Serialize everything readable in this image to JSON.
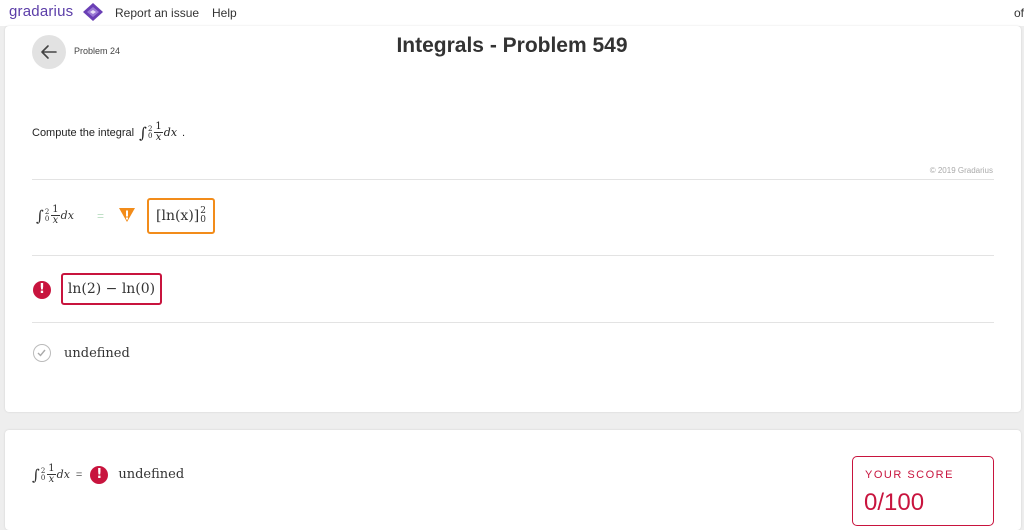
{
  "topbar": {
    "brand": "gradarius",
    "links": [
      "Report an issue",
      "Help"
    ],
    "right_text": "of"
  },
  "header": {
    "problem_label": "Problem 24",
    "title": "Integrals - Problem 549"
  },
  "prompt": {
    "text": "Compute the integral",
    "integral": {
      "lower": "0",
      "upper": "2",
      "numerator": "1",
      "denominator": "x",
      "differential": "dx"
    },
    "trailing": "."
  },
  "copyright": "© 2019 Gradarius",
  "steps": [
    {
      "lhs": {
        "lower": "0",
        "upper": "2",
        "numerator": "1",
        "denominator": "x",
        "differential": "dx"
      },
      "equals": "=",
      "status": "warning",
      "answer": {
        "main": "[ln(x)]",
        "upper": "2",
        "lower": "0"
      }
    },
    {
      "status": "error",
      "answer": "ln(2) − ln(0)"
    },
    {
      "status": "check",
      "answer": "undefined"
    }
  ],
  "summary": {
    "lhs": {
      "lower": "0",
      "upper": "2",
      "numerator": "1",
      "denominator": "x",
      "differential": "dx"
    },
    "equals": "=",
    "status": "error",
    "value": "undefined"
  },
  "score": {
    "label": "YOUR SCORE",
    "value": "0/100"
  },
  "icons": {
    "brand": "gradarius-logo-icon",
    "back": "arrow-left-icon",
    "warning": "warning-triangle-icon",
    "error": "error-circle-icon",
    "check": "check-circle-icon"
  },
  "colors": {
    "brand": "#5b3da8",
    "warning": "#f28c1a",
    "error": "#c8143e",
    "equals_hint": "#b8dcc0"
  }
}
